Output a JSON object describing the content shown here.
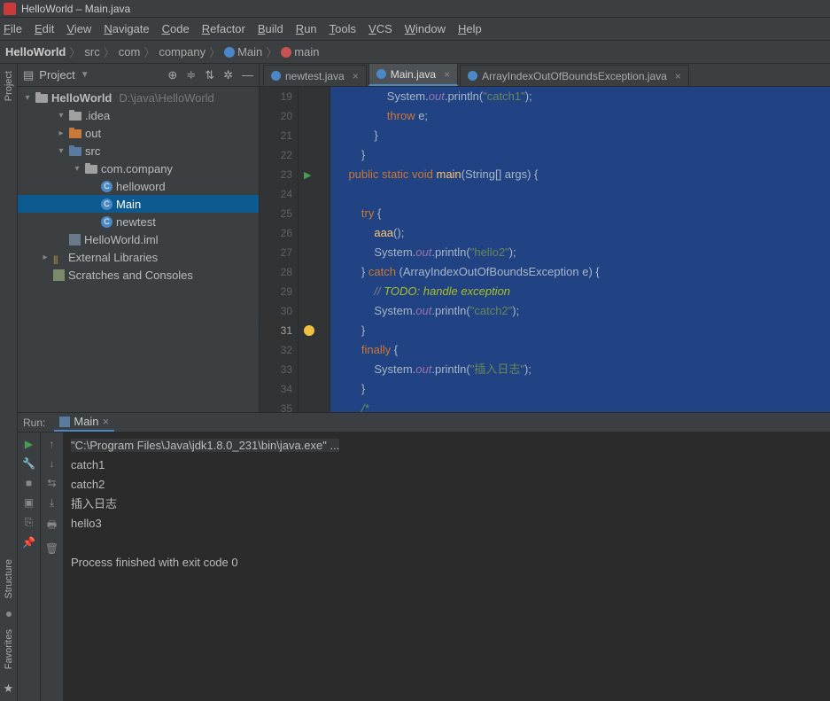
{
  "title": "HelloWorld – Main.java",
  "menu": [
    "File",
    "Edit",
    "View",
    "Navigate",
    "Code",
    "Refactor",
    "Build",
    "Run",
    "Tools",
    "VCS",
    "Window",
    "Help"
  ],
  "crumbs": [
    {
      "label": "HelloWorld",
      "bold": true
    },
    {
      "label": "src"
    },
    {
      "label": "com"
    },
    {
      "label": "company"
    },
    {
      "label": "Main",
      "icon": "blue"
    },
    {
      "label": "main",
      "icon": "red"
    }
  ],
  "project": {
    "title": "Project",
    "root": {
      "label": "HelloWorld",
      "path": "D:\\java\\HelloWorld"
    },
    "tree": [
      {
        "depth": 1,
        "arrow": "down",
        "icon": "folder",
        "label": ".idea"
      },
      {
        "depth": 1,
        "arrow": "right",
        "icon": "folder-orange",
        "label": "out"
      },
      {
        "depth": 1,
        "arrow": "down",
        "icon": "folder-blue",
        "label": "src"
      },
      {
        "depth": 2,
        "arrow": "down",
        "icon": "folder",
        "label": "com.company"
      },
      {
        "depth": 3,
        "arrow": "",
        "icon": "class",
        "label": "helloword"
      },
      {
        "depth": 3,
        "arrow": "",
        "icon": "class",
        "label": "Main",
        "sel": true
      },
      {
        "depth": 3,
        "arrow": "",
        "icon": "class",
        "label": "newtest"
      },
      {
        "depth": 1,
        "arrow": "",
        "icon": "iml",
        "label": "HelloWorld.iml"
      },
      {
        "depth": 0,
        "arrow": "right",
        "icon": "lib",
        "label": "External Libraries"
      },
      {
        "depth": 0,
        "arrow": "",
        "icon": "scratch",
        "label": "Scratches and Consoles"
      }
    ]
  },
  "tabs": [
    {
      "label": "newtest.java",
      "active": false
    },
    {
      "label": "Main.java",
      "active": true
    },
    {
      "label": "ArrayIndexOutOfBoundsException.java",
      "active": false
    }
  ],
  "code": {
    "start": 19,
    "lines": [
      {
        "n": 19,
        "html": "                System.<span class='fld'>out</span>.println(<span class='str'>\"catch1\"</span>);"
      },
      {
        "n": 20,
        "html": "                <span class='kw'>throw</span> e;"
      },
      {
        "n": 21,
        "html": "            }"
      },
      {
        "n": 22,
        "html": "        }"
      },
      {
        "n": 23,
        "html": "    <span class='kw'>public static</span> <span class='kw'>void</span> <span class='fn'>main</span>(String[] args) {",
        "run": true
      },
      {
        "n": 24,
        "html": ""
      },
      {
        "n": 25,
        "html": "        <span class='kw'>try</span> {"
      },
      {
        "n": 26,
        "html": "            <span class='fn'>aaa</span>();"
      },
      {
        "n": 27,
        "html": "            System.<span class='fld'>out</span>.println(<span class='str'>\"hello2\"</span>);"
      },
      {
        "n": 28,
        "html": "        } <span class='kw'>catch</span> (ArrayIndexOutOfBoundsException e) {"
      },
      {
        "n": 29,
        "html": "            <span class='cmt'>// </span><span class='todo'>TODO: handle exception</span>"
      },
      {
        "n": 30,
        "html": "            System.<span class='fld'>out</span>.println(<span class='str'>\"catch2\"</span>);"
      },
      {
        "n": 31,
        "html": "        }",
        "bulb": true,
        "current": true
      },
      {
        "n": 32,
        "html": "        <span class='kw'>finally</span> {"
      },
      {
        "n": 33,
        "html": "            System.<span class='fld'>out</span>.println(<span class='str'>\"插入日志\"</span>);"
      },
      {
        "n": 34,
        "html": "        }"
      },
      {
        "n": 35,
        "html": "        <span class='cmt2'>/*</span>"
      }
    ]
  },
  "run": {
    "title": "Run:",
    "tab": "Main",
    "lines": [
      {
        "text": "\"C:\\Program Files\\Java\\jdk1.8.0_231\\bin\\java.exe\" ...",
        "cmd": true
      },
      {
        "text": "catch1"
      },
      {
        "text": "catch2"
      },
      {
        "text": "插入日志"
      },
      {
        "text": "hello3"
      },
      {
        "text": ""
      },
      {
        "text": "Process finished with exit code 0"
      }
    ]
  },
  "leftlabels": [
    "Project",
    "Structure",
    "Favorites"
  ]
}
